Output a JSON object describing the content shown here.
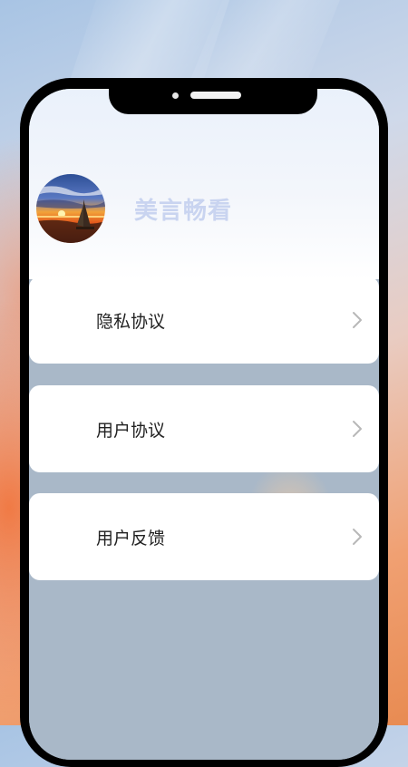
{
  "app": {
    "name": "美言畅看"
  },
  "menu": {
    "items": [
      {
        "label": "隐私协议",
        "icon": "chevron-right-icon"
      },
      {
        "label": "用户协议",
        "icon": "chevron-right-icon"
      },
      {
        "label": "用户反馈",
        "icon": "chevron-right-icon"
      }
    ]
  },
  "colors": {
    "app_name": "#c9d4f0",
    "card_bg": "#ffffff",
    "screen_bg": "#a9b8c8",
    "label_text": "#222222",
    "chevron": "#b8b8b8"
  }
}
